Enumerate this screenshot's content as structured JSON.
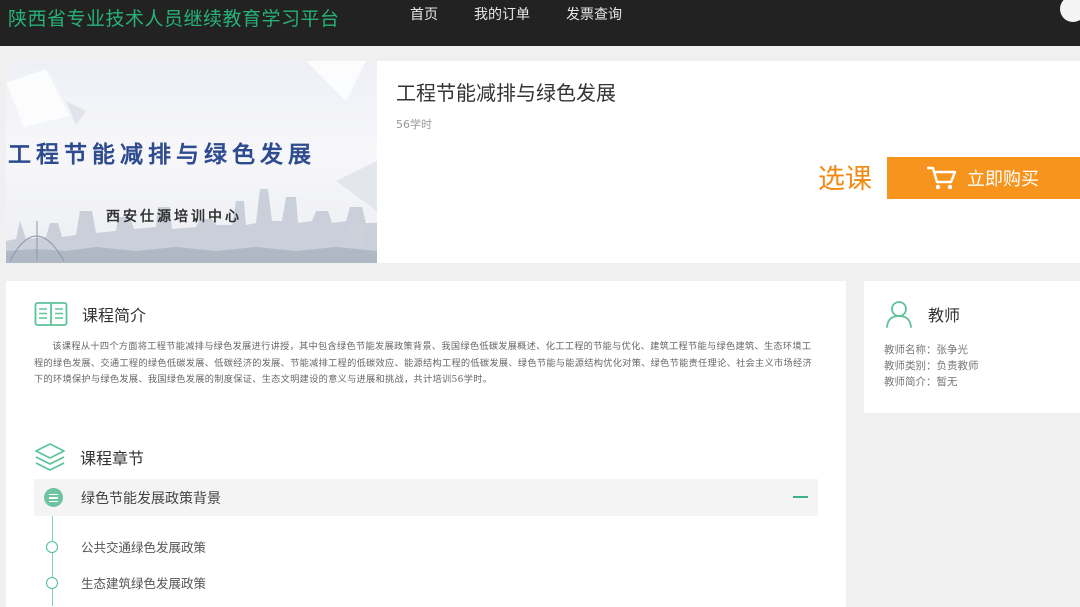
{
  "brand": "陕西省专业技术人员继续教育学习平台",
  "nav": [
    "首页",
    "我的订单",
    "发票查询"
  ],
  "course": {
    "cover_title": "工程节能减排与绿色发展",
    "cover_subtitle": "西安仕源培训中心",
    "name": "工程节能减排与绿色发展",
    "hours": "56学时",
    "select_label": "选课",
    "buy_label": "立即购买"
  },
  "intro": {
    "heading": "课程简介",
    "text": "该课程从十四个方面将工程节能减排与绿色发展进行讲授，其中包含绿色节能发展政策背景、我国绿色低碳发展概述、化工工程的节能与优化、建筑工程节能与绿色建筑、生态环境工程的绿色发展、交通工程的绿色低碳发展、低碳经济的发展、节能减排工程的低碳效应、能源结构工程的低碳发展、绿色节能与能源结构优化对策、绿色节能责任理论、社会主义市场经济下的环境保护与绿色发展、我国绿色发展的制度保证、生态文明建设的意义与进展和挑战，共计培训56学时。"
  },
  "chapters": {
    "heading": "课程章节",
    "items": [
      {
        "title": "绿色节能发展政策背景",
        "lessons": [
          "公共交通绿色发展政策",
          "生态建筑绿色发展政策"
        ]
      }
    ]
  },
  "teacher": {
    "heading": "教师",
    "name_line": "教师名称：张争光",
    "type_line": "教师类别：负责教师",
    "bio_line": "教师简介：暂无"
  },
  "colors": {
    "brand_green": "#27b178",
    "accent_orange": "#f7941d",
    "topbar": "#222222"
  },
  "icons": [
    "book-icon",
    "layers-icon",
    "cart-icon",
    "user-icon",
    "list-icon",
    "minus-icon"
  ]
}
